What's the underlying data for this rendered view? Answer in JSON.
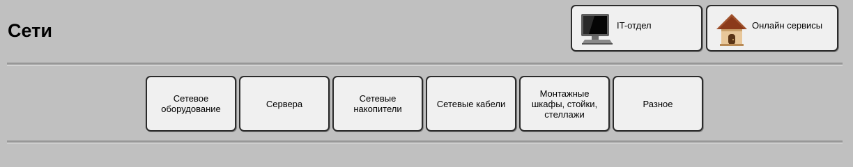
{
  "header": {
    "title": "Сети"
  },
  "quick_links": [
    {
      "label": "IT-отдел",
      "icon": "computer-monitor-icon"
    },
    {
      "label": "Онлайн сервисы",
      "icon": "home-icon"
    }
  ],
  "categories": [
    {
      "label": "Сетевое оборудование"
    },
    {
      "label": "Сервера"
    },
    {
      "label": "Сетевые накопители"
    },
    {
      "label": "Сетевые кабели"
    },
    {
      "label": "Монтажные шкафы, стойки, стеллажи"
    },
    {
      "label": "Разное"
    }
  ]
}
